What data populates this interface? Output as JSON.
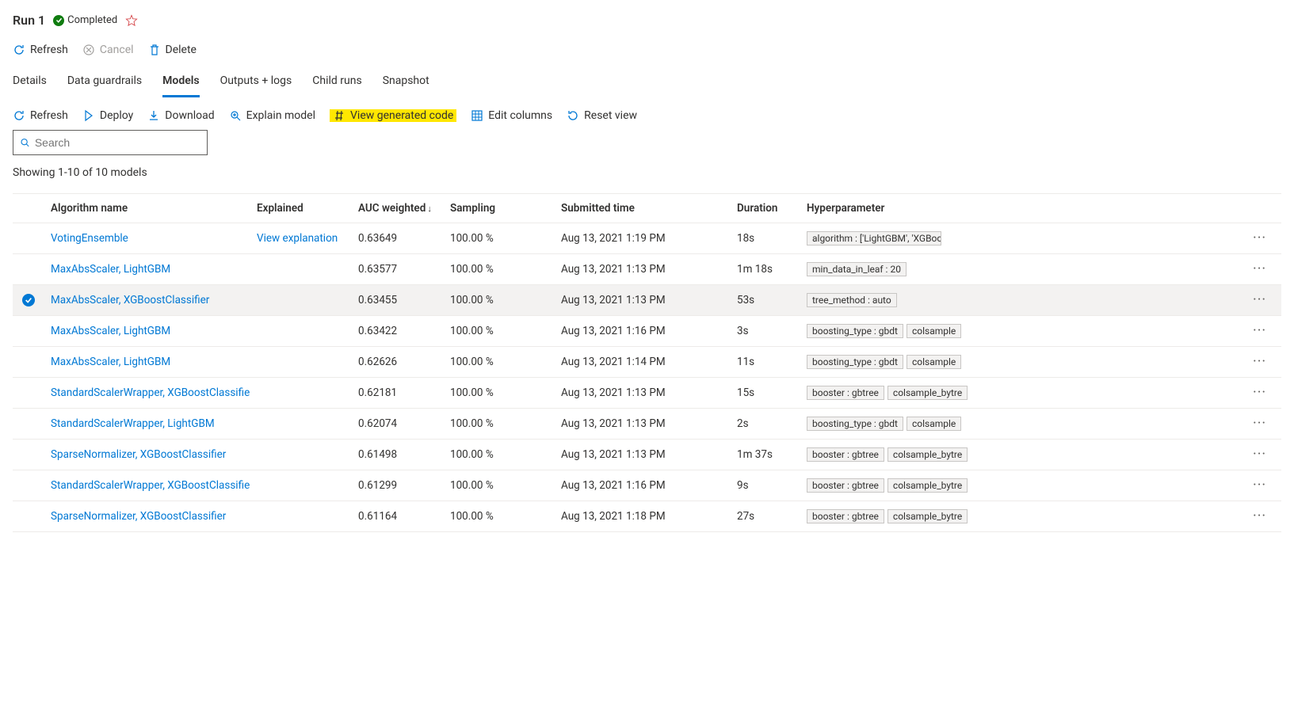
{
  "header": {
    "title": "Run 1",
    "status": "Completed"
  },
  "cmdbar1": {
    "refresh": "Refresh",
    "cancel": "Cancel",
    "delete": "Delete"
  },
  "pivot": {
    "details": "Details",
    "guardrails": "Data guardrails",
    "models": "Models",
    "outputs": "Outputs + logs",
    "childruns": "Child runs",
    "snapshot": "Snapshot"
  },
  "cmdbar2": {
    "refresh": "Refresh",
    "deploy": "Deploy",
    "download": "Download",
    "explain": "Explain model",
    "viewcode": "View generated code",
    "editcols": "Edit columns",
    "resetview": "Reset view"
  },
  "search": {
    "placeholder": "Search"
  },
  "results_count": "Showing 1-10 of 10 models",
  "columns": {
    "algorithm": "Algorithm name",
    "explained": "Explained",
    "auc": "AUC weighted",
    "sampling": "Sampling",
    "submitted": "Submitted time",
    "duration": "Duration",
    "hyper": "Hyperparameter"
  },
  "more_label": "···",
  "rows": [
    {
      "algorithm": "VotingEnsemble",
      "explained": "View explanation",
      "auc": "0.63649",
      "sampling": "100.00 %",
      "submitted": "Aug 13, 2021 1:19 PM",
      "duration": "18s",
      "hyper": [
        "algorithm : ['LightGBM', 'XGBoostC"
      ],
      "selected": false
    },
    {
      "algorithm": "MaxAbsScaler, LightGBM",
      "explained": "",
      "auc": "0.63577",
      "sampling": "100.00 %",
      "submitted": "Aug 13, 2021 1:13 PM",
      "duration": "1m 18s",
      "hyper": [
        "min_data_in_leaf : 20"
      ],
      "selected": false
    },
    {
      "algorithm": "MaxAbsScaler, XGBoostClassifier",
      "explained": "",
      "auc": "0.63455",
      "sampling": "100.00 %",
      "submitted": "Aug 13, 2021 1:13 PM",
      "duration": "53s",
      "hyper": [
        "tree_method : auto"
      ],
      "selected": true
    },
    {
      "algorithm": "MaxAbsScaler, LightGBM",
      "explained": "",
      "auc": "0.63422",
      "sampling": "100.00 %",
      "submitted": "Aug 13, 2021 1:16 PM",
      "duration": "3s",
      "hyper": [
        "boosting_type : gbdt",
        "colsample"
      ],
      "selected": false
    },
    {
      "algorithm": "MaxAbsScaler, LightGBM",
      "explained": "",
      "auc": "0.62626",
      "sampling": "100.00 %",
      "submitted": "Aug 13, 2021 1:14 PM",
      "duration": "11s",
      "hyper": [
        "boosting_type : gbdt",
        "colsample"
      ],
      "selected": false
    },
    {
      "algorithm": "StandardScalerWrapper, XGBoostClassifier",
      "explained": "",
      "auc": "0.62181",
      "sampling": "100.00 %",
      "submitted": "Aug 13, 2021 1:13 PM",
      "duration": "15s",
      "hyper": [
        "booster : gbtree",
        "colsample_bytre"
      ],
      "selected": false
    },
    {
      "algorithm": "StandardScalerWrapper, LightGBM",
      "explained": "",
      "auc": "0.62074",
      "sampling": "100.00 %",
      "submitted": "Aug 13, 2021 1:13 PM",
      "duration": "2s",
      "hyper": [
        "boosting_type : gbdt",
        "colsample"
      ],
      "selected": false
    },
    {
      "algorithm": "SparseNormalizer, XGBoostClassifier",
      "explained": "",
      "auc": "0.61498",
      "sampling": "100.00 %",
      "submitted": "Aug 13, 2021 1:13 PM",
      "duration": "1m 37s",
      "hyper": [
        "booster : gbtree",
        "colsample_bytre"
      ],
      "selected": false
    },
    {
      "algorithm": "StandardScalerWrapper, XGBoostClassifier",
      "explained": "",
      "auc": "0.61299",
      "sampling": "100.00 %",
      "submitted": "Aug 13, 2021 1:16 PM",
      "duration": "9s",
      "hyper": [
        "booster : gbtree",
        "colsample_bytre"
      ],
      "selected": false
    },
    {
      "algorithm": "SparseNormalizer, XGBoostClassifier",
      "explained": "",
      "auc": "0.61164",
      "sampling": "100.00 %",
      "submitted": "Aug 13, 2021 1:18 PM",
      "duration": "27s",
      "hyper": [
        "booster : gbtree",
        "colsample_bytre"
      ],
      "selected": false
    }
  ]
}
